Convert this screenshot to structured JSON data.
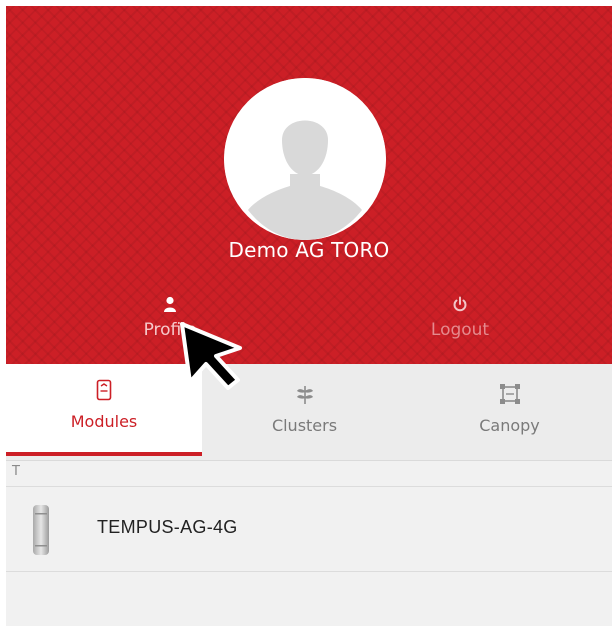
{
  "header": {
    "user_name": "Demo AG TORO",
    "profile_label": "Profile",
    "logout_label": "Logout",
    "avatar_icon": "person-silhouette-icon",
    "profile_icon": "person-icon",
    "logout_icon": "power-icon",
    "accent_color": "#cc1f26"
  },
  "tabs": [
    {
      "label": "Modules",
      "icon": "module-icon",
      "active": true
    },
    {
      "label": "Clusters",
      "icon": "leaf-icon",
      "active": false
    },
    {
      "label": "Canopy",
      "icon": "frame-icon",
      "active": false
    }
  ],
  "list": {
    "section_letter": "T",
    "items": [
      {
        "name": "TEMPUS-AG-4G",
        "icon": "device-sensor-icon"
      }
    ]
  },
  "cursor": {
    "icon": "mouse-pointer-icon"
  }
}
